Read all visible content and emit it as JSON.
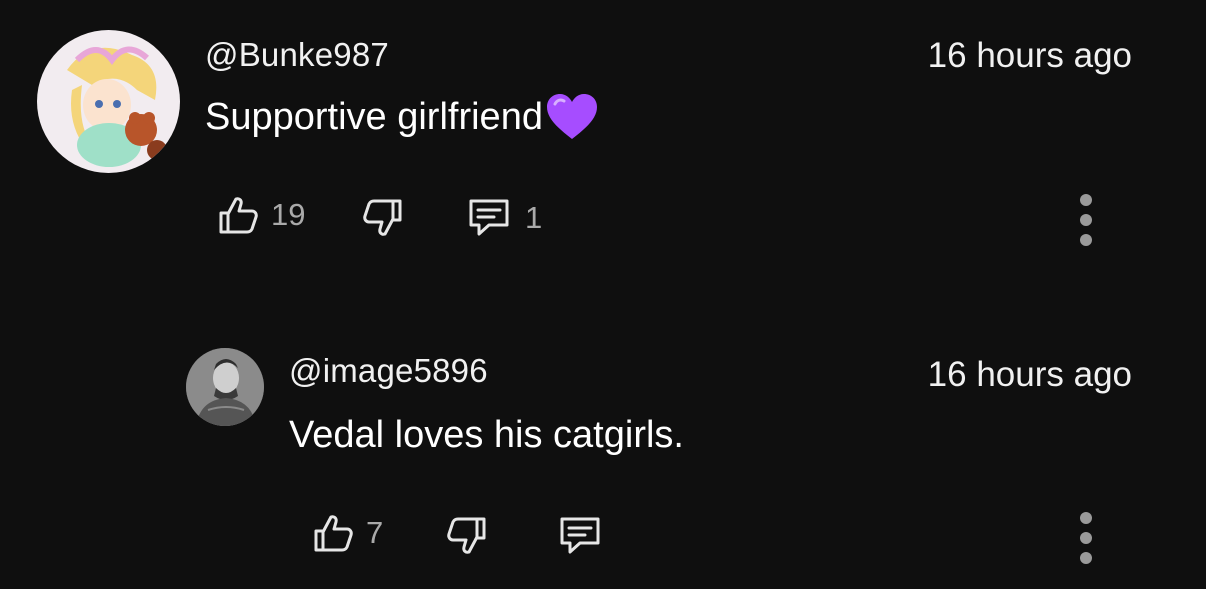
{
  "comments": [
    {
      "author": "@Bunke987",
      "time": "16 hours ago",
      "text": "Supportive girlfriend",
      "emoji": "purple-heart",
      "likes": "19",
      "replies": "1"
    },
    {
      "author": "@image5896",
      "time": "16 hours ago",
      "text": "Vedal loves his catgirls.",
      "likes": "7",
      "replies": ""
    }
  ],
  "colors": {
    "background": "#0f0f0f",
    "text": "#f1f1f1",
    "muted": "#aaaaaa",
    "heart": "#a64dff"
  }
}
